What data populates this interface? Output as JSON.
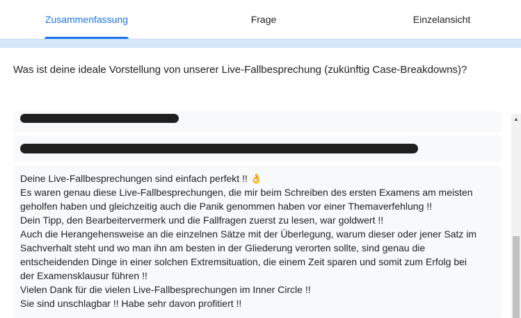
{
  "tabs": [
    {
      "label": "Zusammenfassung",
      "active": true
    },
    {
      "label": "Frage",
      "active": false
    },
    {
      "label": "Einzelansicht",
      "active": false
    }
  ],
  "question": "Was ist deine ideale Vorstellung von unserer Live-Fallbesprechung (zukünftig Case-Breakdowns)?",
  "response_lines": [
    "Deine Live-Fallbesprechungen sind einfach perfekt !! 👌",
    "Es waren genau diese Live-Fallbesprechungen, die mir beim Schreiben des ersten Examens am meisten",
    "geholfen haben und gleichzeitig auch die Panik genommen haben vor einer Themaverfehlung !!",
    "Dein Tipp, den Bearbeitervermerk und die Fallfragen zuerst zu lesen, war goldwert !!",
    "Auch die Herangehensweise an die einzelnen Sätze mit der Überlegung, warum dieser oder jener Satz im",
    "Sachverhalt steht und wo man ihn am besten in der Gliederung verorten sollte, sind genau die",
    "entscheidenden Dinge in einer solchen Extremsituation, die einem Zeit sparen und somit zum Erfolg bei",
    "der Examensklausur führen !!",
    "Vielen Dank für die vielen Live-Fallbesprechungen im Inner Circle !!",
    "Sie sind unschlagbar !! Habe sehr davon profitiert !!"
  ],
  "colors": {
    "accent": "#1a73e8",
    "band": "#d6e6fb",
    "card": "#f8f9fa"
  }
}
